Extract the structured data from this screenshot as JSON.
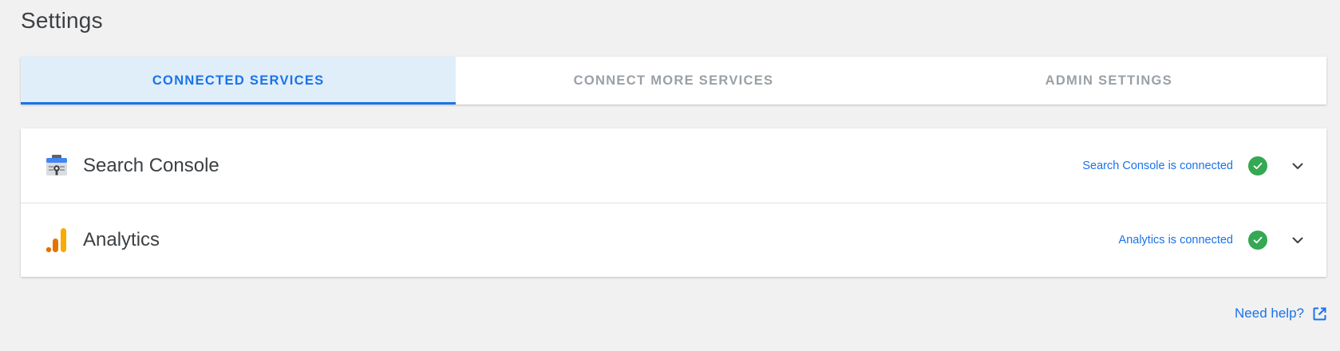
{
  "page": {
    "title": "Settings"
  },
  "tabs": [
    {
      "label": "CONNECTED SERVICES",
      "active": true
    },
    {
      "label": "CONNECT MORE SERVICES",
      "active": false
    },
    {
      "label": "ADMIN SETTINGS",
      "active": false
    }
  ],
  "services": [
    {
      "name": "Search Console",
      "status": "Search Console is connected",
      "icon": "search-console-icon"
    },
    {
      "name": "Analytics",
      "status": "Analytics is connected",
      "icon": "analytics-icon"
    }
  ],
  "help": {
    "label": "Need help?",
    "icon": "external-link-icon"
  },
  "colors": {
    "accent": "#1a73e8",
    "active_tab_bg": "#e0eefa",
    "success": "#34a853",
    "analytics_orange": "#f9ab00",
    "analytics_dark_orange": "#e37400",
    "background": "#f1f1f1"
  }
}
